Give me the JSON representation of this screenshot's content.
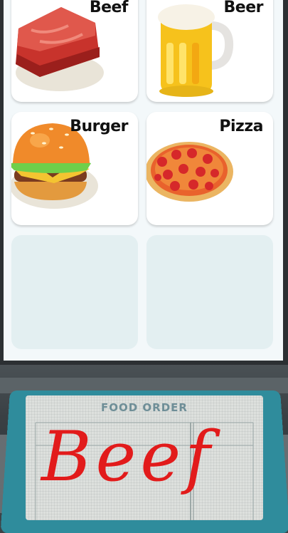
{
  "menu": {
    "items": [
      {
        "label": "Beef"
      },
      {
        "label": "Beer"
      },
      {
        "label": "Burger"
      },
      {
        "label": "Pizza"
      }
    ]
  },
  "order": {
    "heading": "FOOD ORDER",
    "requested_item": "Beef"
  },
  "colors": {
    "order_card": "#2f8c9c",
    "handwriting": "#e21b1b",
    "empty_slot": "#e3eff1"
  }
}
